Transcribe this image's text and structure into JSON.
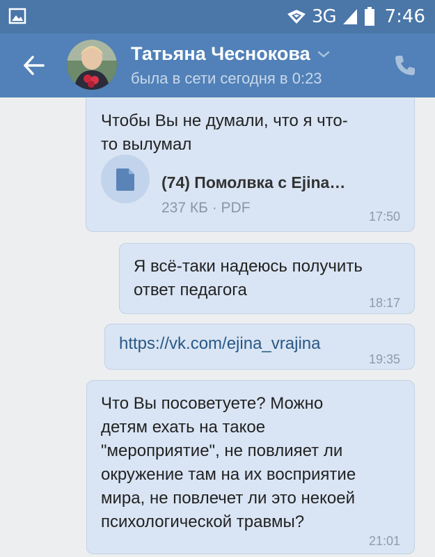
{
  "status_bar": {
    "network": "3G",
    "time": "7:46"
  },
  "header": {
    "contact_name": "Татьяна Чеснокова",
    "last_seen": "была в сети сегодня в 0:23"
  },
  "messages": [
    {
      "type": "file",
      "text_lines": [
        "Чтобы Вы не думали, что я что-",
        "то вылумал"
      ],
      "file_name": "(74) Помолвка с Ejina…",
      "file_meta": "237 КБ · PDF",
      "time": "17:50"
    },
    {
      "type": "text",
      "text_lines": [
        "Я всё-таки надеюсь получить",
        "ответ педагога"
      ],
      "time": "18:17"
    },
    {
      "type": "link",
      "url": "https://vk.com/ejina_vrajina",
      "time": "19:35"
    },
    {
      "type": "text",
      "text_lines": [
        "Что Вы посоветуете? Можно",
        "детям ехать на такое",
        "\"мероприятие\", не повлияет ли",
        "окружение там на их восприятие",
        "мира, не повлечет ли это некоей",
        "психологической травмы?"
      ],
      "time": "21:01"
    }
  ],
  "icons": {
    "gallery": "gallery-icon",
    "wifi": "wifi-icon",
    "signal": "signal-icon",
    "battery": "battery-icon",
    "back": "back-arrow-icon",
    "chevron": "chevron-down-icon",
    "call": "phone-icon",
    "document": "document-icon"
  },
  "colors": {
    "status_bar": "#4a76a8",
    "header": "#5181b8",
    "background": "#edeef0",
    "bubble": "#d9e5f4",
    "link": "#2a5885"
  }
}
